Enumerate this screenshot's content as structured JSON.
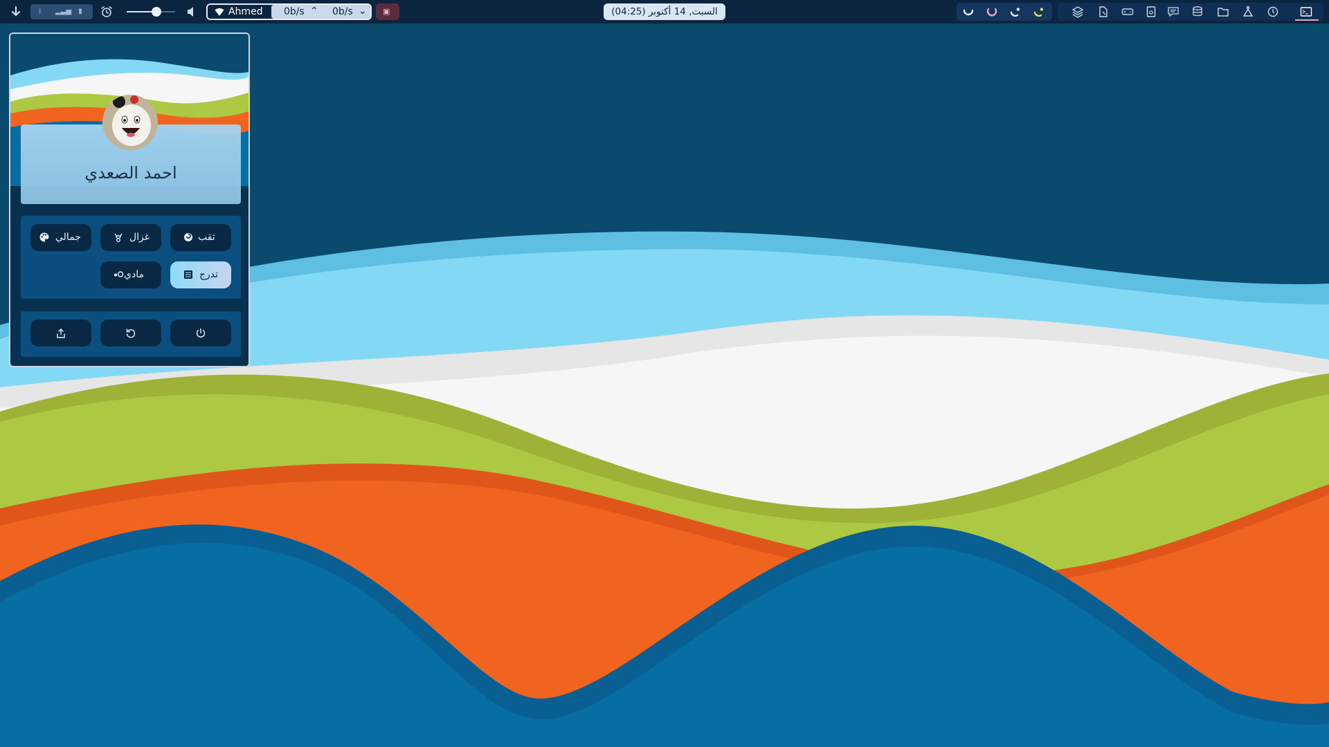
{
  "topbar": {
    "network": {
      "ssid": "Ahmed",
      "upload_rate": "0b/s",
      "download_rate": "0b/s"
    },
    "volume_level": 0.62,
    "clock": "(04:25) السبت, 14 أكتوبر",
    "status_rings": [
      {
        "name": "cpu-ring",
        "color": "#e9f0f7"
      },
      {
        "name": "memory-ring",
        "color": "#e9a7bd"
      },
      {
        "name": "disk-ring",
        "color": "#e9f0f7"
      },
      {
        "name": "battery-ring",
        "color": "#e8e34a"
      }
    ],
    "apps": [
      "layers-icon",
      "paint-icon",
      "gamepad-icon",
      "pdf-icon",
      "chat-icon",
      "database-icon",
      "folder-icon",
      "flask-icon",
      "vpn-icon",
      "terminal-icon"
    ]
  },
  "profile": {
    "display_name": "احمد الصعدي"
  },
  "theme_buttons": [
    {
      "label": "ثقب",
      "icon": "swirl-icon",
      "active": false
    },
    {
      "label": "غزال",
      "icon": "deer-icon",
      "active": false
    },
    {
      "label": "جمالي",
      "icon": "palette-icon",
      "active": false
    },
    {
      "label": "تدرج",
      "icon": "gradient-icon",
      "active": true
    },
    {
      "label": "مادي",
      "icon": "material-icon",
      "active": false
    }
  ],
  "power_buttons": [
    "power-icon",
    "restart-icon",
    "logout-icon"
  ],
  "colors": {
    "bar_bg": "#0b2440",
    "accent_light_blue": "#8fdcf7",
    "wave_green": "#a7c23a",
    "wave_orange": "#f0621d",
    "wave_blue": "#066ea2"
  }
}
